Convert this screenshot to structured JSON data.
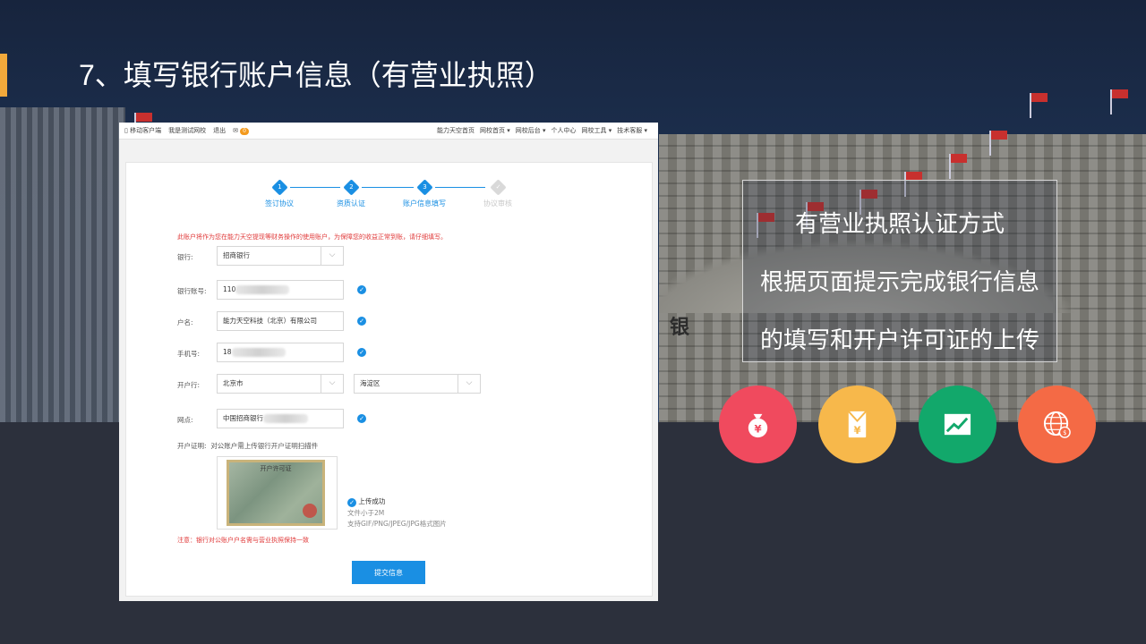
{
  "slide": {
    "title": "7、填写银行账户信息（有营业执照）",
    "accent_color": "#f2a93b"
  },
  "topnav": {
    "left_items": [
      "移动客户端",
      "我是测试网校",
      "退出"
    ],
    "mail_badge": "0",
    "right_items": [
      "能力天空首页",
      "网校首页 ▾",
      "网校后台 ▾",
      "个人中心",
      "网校工具 ▾",
      "技术客服 ▾"
    ]
  },
  "steps": [
    {
      "num": "1",
      "label": "签订协议",
      "active": true
    },
    {
      "num": "2",
      "label": "资质认证",
      "active": true
    },
    {
      "num": "3",
      "label": "账户信息填写",
      "active": true
    },
    {
      "num": "✓",
      "label": "协议审核",
      "active": false
    }
  ],
  "form": {
    "notice": "此账户将作为您在能力天空提现等财务操作的使用账户，为保障您的收益正常到账，请仔细填写。",
    "bank_label": "银行:",
    "bank_value": "招商银行",
    "account_label": "银行账号:",
    "account_value": "110",
    "holder_label": "户名:",
    "holder_value": "能力天空科技（北京）有限公司",
    "phone_label": "手机号:",
    "phone_value": "18",
    "branch_city_label": "开户行:",
    "branch_city_value": "北京市",
    "branch_district_value": "海淀区",
    "outlet_label": "网点:",
    "outlet_value": "中国招商银行",
    "cert_label": "开户证明:",
    "cert_hint": "对公账户需上传银行开户证明扫描件",
    "cert_image_title": "开户许可证",
    "upload_ok": "上传成功",
    "upload_size": "文件小于2M",
    "upload_formats": "支持GIF/PNG/JPEG/JPG格式图片",
    "warn": "注意：银行对公账户户名需与营业执照保持一致",
    "submit_label": "提交信息"
  },
  "info": {
    "lines": [
      "有营业执照认证方式",
      "根据页面提示完成银行信息",
      "的填写和开户许可证的上传"
    ]
  },
  "icons": [
    {
      "name": "money-bag-icon",
      "color": "#f04a5e"
    },
    {
      "name": "yen-envelope-icon",
      "color": "#f7b84b"
    },
    {
      "name": "trend-chart-icon",
      "color": "#12a86b"
    },
    {
      "name": "globe-coin-icon",
      "color": "#f46a45"
    }
  ],
  "building_sign": "银"
}
